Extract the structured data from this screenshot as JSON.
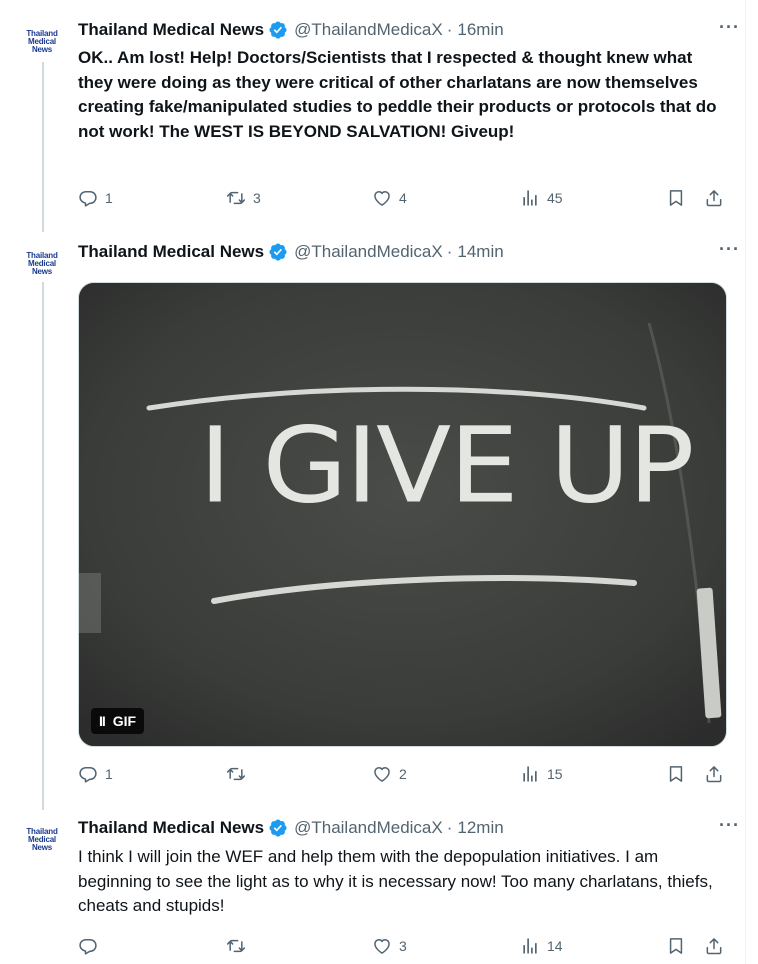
{
  "tweets": [
    {
      "avatar": [
        "Thailand",
        "Medical",
        "News"
      ],
      "name": "Thailand Medical News",
      "handle": "@ThailandMedicaX",
      "separator": "·",
      "time": "16min",
      "more": "···",
      "text": "OK.. Am lost! Help! Doctors/Scientists that I respected & thought knew what they were doing as they were critical of other charlatans are now themselves creating fake/manipulated studies to peddle their products or protocols that do not work! The WEST IS BEYOND SALVATION! Giveup!",
      "replies": "1",
      "retweets": "3",
      "likes": "4",
      "views": "45"
    },
    {
      "avatar": [
        "Thailand",
        "Medical",
        "News"
      ],
      "name": "Thailand Medical News",
      "handle": "@ThailandMedicaX",
      "separator": "·",
      "time": "14min",
      "more": "···",
      "media": {
        "chalk_text": "I GIVE UP",
        "badge_icon": "II",
        "badge_label": "GIF"
      },
      "replies": "1",
      "retweets": "",
      "likes": "2",
      "views": "15"
    },
    {
      "avatar": [
        "Thailand",
        "Medical",
        "News"
      ],
      "name": "Thailand Medical News",
      "handle": "@ThailandMedicaX",
      "separator": "·",
      "time": "12min",
      "more": "···",
      "text": "I think I will join the WEF and help them with the depopulation initiatives. I am beginning to see the light as to why it is necessary now! Too many charlatans, thiefs, cheats and stupids!",
      "replies": "",
      "retweets": "",
      "likes": "3",
      "views": "14"
    }
  ],
  "colors": {
    "verified": "#1d9bf0",
    "muted": "#536471",
    "avatar_text": "#1b3a8f",
    "thread_line": "#cfd9de"
  },
  "icons": [
    "verified-badge-icon",
    "reply-icon",
    "retweet-icon",
    "like-icon",
    "views-icon",
    "bookmark-icon",
    "share-icon",
    "more-icon",
    "pause-icon"
  ]
}
